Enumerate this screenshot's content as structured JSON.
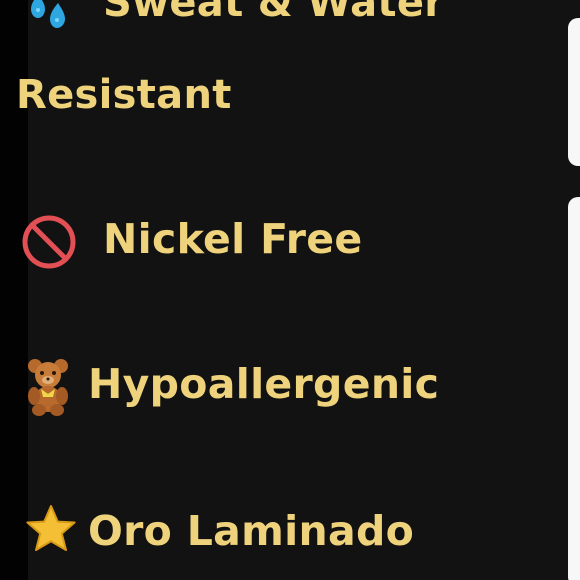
{
  "features": {
    "items": [
      {
        "text_a": "Sweat & Water",
        "text_b": "Resistant",
        "icon": "water-drops-icon"
      },
      {
        "text": "Nickel Free",
        "icon": "no-sign-icon"
      },
      {
        "text": "Hypoallergenic",
        "icon": "teddy-bear-icon"
      },
      {
        "text": "Oro Laminado",
        "icon": "star-icon"
      }
    ],
    "colors": {
      "text": "#efd27c",
      "background": "#121212",
      "no_sign": "#e24f55",
      "star": "#f4bf35",
      "bear": "#b86a2d",
      "water": "#2ea7e0"
    }
  }
}
